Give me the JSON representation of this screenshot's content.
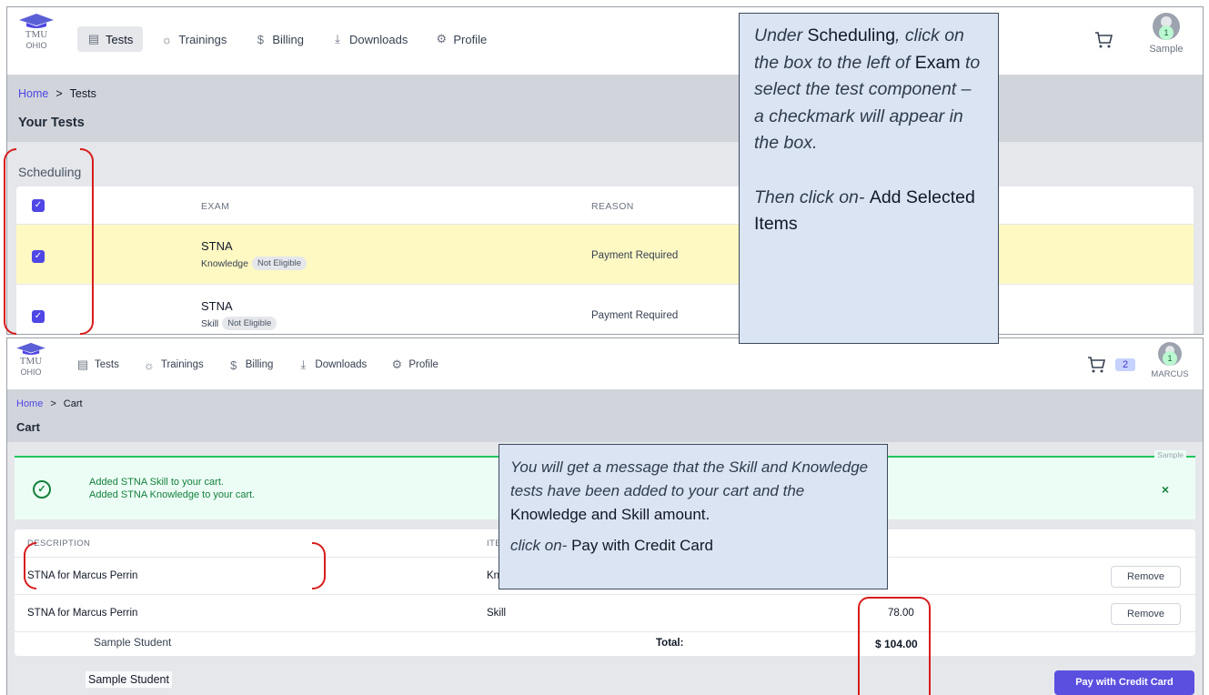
{
  "top": {
    "logo": {
      "line1": "TMU",
      "line2": "OHIO"
    },
    "nav": [
      {
        "label": "Tests",
        "icon": "clipboard-icon"
      },
      {
        "label": "Trainings",
        "icon": "lightbulb-icon"
      },
      {
        "label": "Billing",
        "icon": "dollar-icon"
      },
      {
        "label": "Downloads",
        "icon": "download-icon"
      },
      {
        "label": "Profile",
        "icon": "gear-icon"
      }
    ],
    "user": {
      "name": "Sample",
      "badge": "1"
    },
    "breadcrumb": {
      "home": "Home",
      "sep": ">",
      "current": "Tests"
    },
    "page_title": "Your Tests",
    "section_title": "Scheduling",
    "table": {
      "headers": [
        "EXAM",
        "REASON"
      ],
      "rows": [
        {
          "exam": "STNA",
          "component": "Knowledge",
          "status": "Not Eligible",
          "reason": "Payment Required"
        },
        {
          "exam": "STNA",
          "component": "Skill",
          "status": "Not Eligible",
          "reason": "Payment Required"
        }
      ]
    }
  },
  "bottom": {
    "logo": {
      "line1": "TMU",
      "line2": "OHIO"
    },
    "nav": [
      {
        "label": "Tests",
        "icon": "clipboard-icon"
      },
      {
        "label": "Trainings",
        "icon": "lightbulb-icon"
      },
      {
        "label": "Billing",
        "icon": "dollar-icon"
      },
      {
        "label": "Downloads",
        "icon": "download-icon"
      },
      {
        "label": "Profile",
        "icon": "gear-icon"
      }
    ],
    "cart_count": "2",
    "user": {
      "name": "MARCUS",
      "badge": "1"
    },
    "breadcrumb": {
      "home": "Home",
      "sep": ">",
      "current": "Cart"
    },
    "page_title": "Cart",
    "alert": {
      "tag": "Sample",
      "lines": [
        "Added STNA Skill to your cart.",
        "Added STNA Knowledge to your cart."
      ],
      "close": "×"
    },
    "cart_table": {
      "headers": [
        "DESCRIPTION",
        "ITE"
      ],
      "rows": [
        {
          "description": "STNA for Marcus Perrin",
          "item": "Kn",
          "amount": "",
          "action": "Remove"
        },
        {
          "description": "STNA for Marcus Perrin",
          "item": "Skill",
          "amount": "78.00",
          "action": "Remove"
        }
      ],
      "signature_1": "Sample Student",
      "total_label": "Total:",
      "total_amount": "$ 104.00"
    },
    "signature_2": "Sample Student",
    "pay_button": "Pay with Credit Card"
  },
  "callout_1": {
    "p1_a": "Under",
    "p1_b": "Scheduling",
    "p1_c": ", click on the box to the left of",
    "p1_d": "Exam",
    "p1_e": "to select the test component – a checkmark will appear in the box.",
    "p2_a": "Then click on-",
    "p2_b": "Add Selected Items"
  },
  "callout_2": {
    "l1_a": "You will get a message that the Skill and Knowledge tests have been added to your cart and the",
    "l1_b": "Knowledge and Skill amount.",
    "l2_a": "click on-",
    "l2_b": "Pay with Credit Card"
  },
  "colors": {
    "accent": "#4f46e5",
    "success": "#15803d",
    "highlight_row": "#fef9c3",
    "callout_bg": "#dbe4f3",
    "annotation_red": "#d81b1b"
  }
}
